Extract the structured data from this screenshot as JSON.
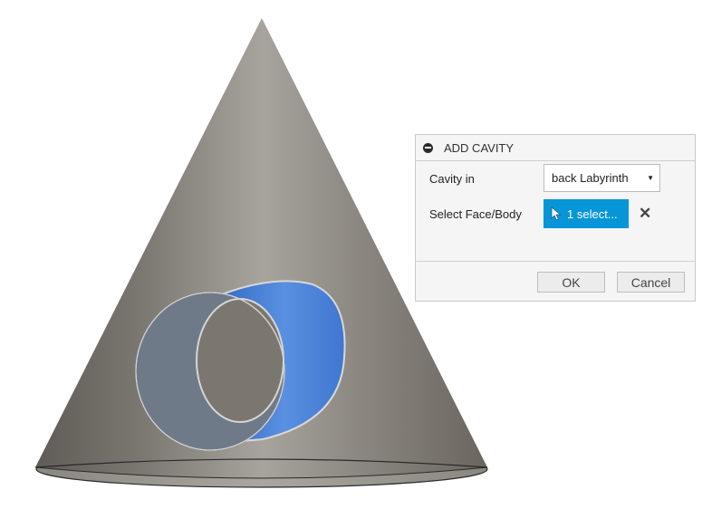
{
  "dialog": {
    "title": "ADD CAVITY",
    "cavity_in_label": "Cavity in",
    "cavity_in_value": "back Labyrinth",
    "select_label": "Select Face/Body",
    "select_value": "1 select...",
    "ok_label": "OK",
    "cancel_label": "Cancel"
  },
  "icons": {
    "collapse": "collapse-icon",
    "dropdown": "chevron-down-icon",
    "cursor": "cursor-arrow-icon",
    "clear": "close-icon"
  },
  "colors": {
    "accent": "#0696d7",
    "selection_face": "#3f7fd6",
    "cone_gray": "#8a857e"
  }
}
